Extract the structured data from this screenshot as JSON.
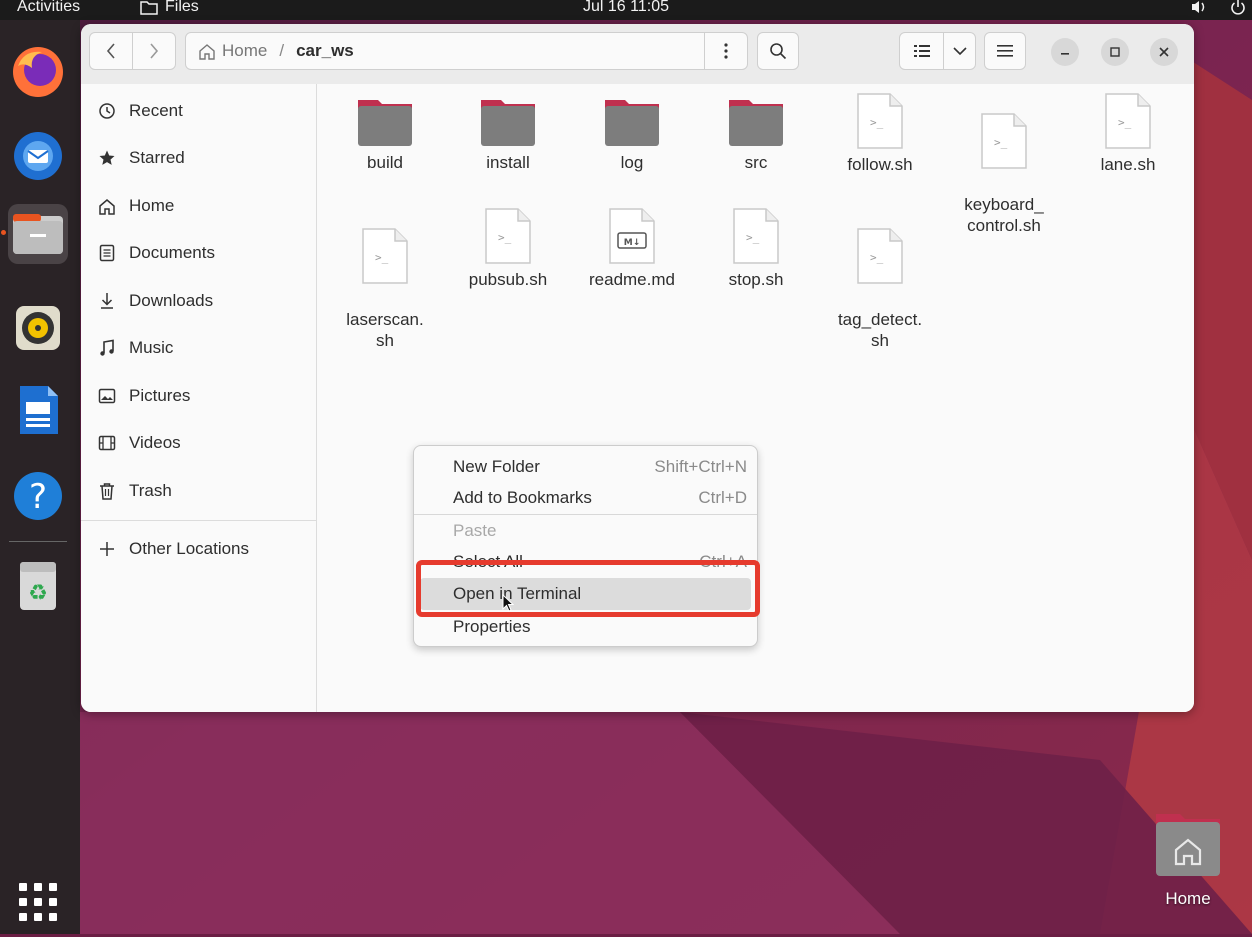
{
  "topbar": {
    "activities": "Activities",
    "app_name": "Files",
    "clock": "Jul 16  11:05"
  },
  "dock": {
    "items": [
      "firefox-icon",
      "thunderbird-icon",
      "files-icon",
      "rhythmbox-icon",
      "libreoffice-writer-icon",
      "help-icon",
      "trash-icon",
      "app-grid-icon"
    ]
  },
  "pathbar": {
    "home": "Home",
    "separator": "/",
    "current": "car_ws"
  },
  "sidebar": {
    "items": [
      {
        "label": "Recent",
        "icon": "clock-icon"
      },
      {
        "label": "Starred",
        "icon": "star-icon"
      },
      {
        "label": "Home",
        "icon": "home-icon"
      },
      {
        "label": "Documents",
        "icon": "document-icon"
      },
      {
        "label": "Downloads",
        "icon": "download-icon"
      },
      {
        "label": "Music",
        "icon": "music-icon"
      },
      {
        "label": "Pictures",
        "icon": "picture-icon"
      },
      {
        "label": "Videos",
        "icon": "video-icon"
      },
      {
        "label": "Trash",
        "icon": "trash-icon"
      }
    ],
    "other_locations": "Other Locations"
  },
  "files": [
    {
      "name": "build",
      "type": "folder"
    },
    {
      "name": "install",
      "type": "folder"
    },
    {
      "name": "log",
      "type": "folder"
    },
    {
      "name": "src",
      "type": "folder"
    },
    {
      "name": "follow.sh",
      "type": "script"
    },
    {
      "name": "keyboard_\ncontrol.sh",
      "type": "script"
    },
    {
      "name": "lane.sh",
      "type": "script"
    },
    {
      "name": "laserscan.\nsh",
      "type": "script"
    },
    {
      "name": "pubsub.sh",
      "type": "script"
    },
    {
      "name": "readme.md",
      "type": "markdown"
    },
    {
      "name": "stop.sh",
      "type": "script"
    },
    {
      "name": "tag_detect.\nsh",
      "type": "script"
    }
  ],
  "context_menu": {
    "items": [
      {
        "label": "New Folder",
        "accel": "Shift+Ctrl+N",
        "enabled": true
      },
      {
        "label": "Add to Bookmarks",
        "accel": "Ctrl+D",
        "enabled": true
      },
      {
        "label": "Paste",
        "accel": "",
        "enabled": false
      },
      {
        "label": "Select All",
        "accel": "Ctrl+A",
        "enabled": true
      },
      {
        "label": "Open in Terminal",
        "accel": "",
        "enabled": true,
        "hovered": true
      },
      {
        "label": "Properties",
        "accel": "",
        "enabled": true
      }
    ]
  },
  "desktop": {
    "home_label": "Home"
  },
  "colors": {
    "accent": "#e95420",
    "highlight_box": "#e63b2e",
    "folder": "#7d7d7d",
    "folder_tab": "#c0304f"
  }
}
